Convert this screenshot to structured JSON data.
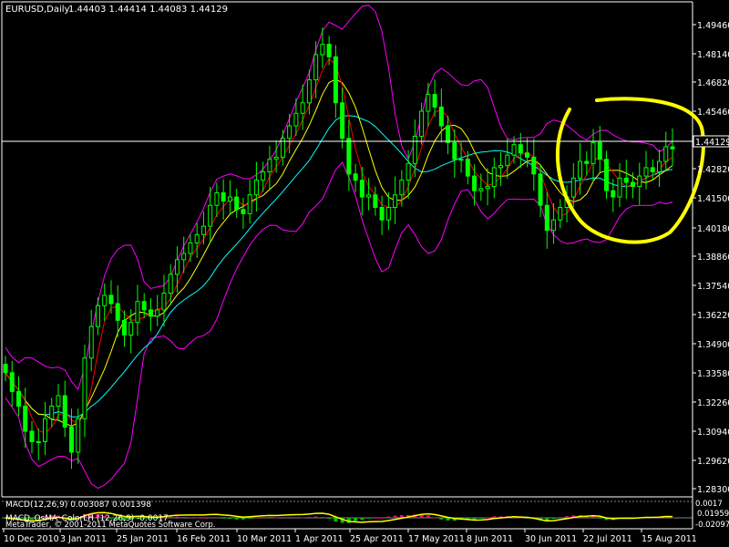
{
  "chart_header": {
    "symbol_label": "EURUSD,Daily",
    "ohlc_text": "1.44403 1.44414 1.44083 1.44129"
  },
  "price_axis": {
    "current_price_label": "1.44129",
    "ticks": [
      "1.49460",
      "1.48140",
      "1.46820",
      "1.45460",
      "1.42820",
      "1.41500",
      "1.40180",
      "1.38860",
      "1.37540",
      "1.36220",
      "1.34900",
      "1.33580",
      "1.32260",
      "1.30940",
      "1.29620",
      "1.28300"
    ]
  },
  "time_axis": {
    "labels": [
      "10 Dec 2010",
      "3 Jan 2011",
      "25 Jan 2011",
      "16 Feb 2011",
      "10 Mar 2011",
      "1 Apr 2011",
      "25 Apr 2011",
      "17 May 2011",
      "8 Jun 2011",
      "30 Jun 2011",
      "22 Jul 2011",
      "15 Aug 2011"
    ]
  },
  "indicator_panel": {
    "macd_label": "MACD(12,26,9) 0.003087 0.001398",
    "osma_label": "MACD_OsMA_ColorLH (12,26,9) -0.0017",
    "copyright": "MetaTrader, © 2001-2011 MetaQuotes Software Corp.",
    "axis_top": "0.01959",
    "axis_bottom": "-0.02097",
    "axis_extra": "0.0017"
  },
  "colors": {
    "background": "#000000",
    "candles": "#00ff00",
    "bollinger": "#ff00ff",
    "ma_fast": "#ff0000",
    "ma_mid": "#ffff00",
    "ma_slow": "#00ffff",
    "price_line": "#ffffff",
    "annotation": "#ffff00"
  },
  "chart_data": {
    "type": "candlestick",
    "symbol": "EURUSD",
    "timeframe": "Daily",
    "last": {
      "open": 1.44403,
      "high": 1.44414,
      "low": 1.44083,
      "close": 1.44129
    },
    "ylim": [
      1.2768,
      1.5078
    ],
    "x_ticks": [
      "10 Dec 2010",
      "3 Jan 2011",
      "25 Jan 2011",
      "16 Feb 2011",
      "10 Mar 2011",
      "1 Apr 2011",
      "25 Apr 2011",
      "17 May 2011",
      "8 Jun 2011",
      "30 Jun 2011",
      "22 Jul 2011",
      "15 Aug 2011"
    ],
    "close_path": [
      1.334,
      1.325,
      1.318,
      1.306,
      1.301,
      1.301,
      1.312,
      1.318,
      1.323,
      1.308,
      1.296,
      1.312,
      1.341,
      1.356,
      1.366,
      1.371,
      1.367,
      1.359,
      1.352,
      1.358,
      1.368,
      1.364,
      1.361,
      1.364,
      1.372,
      1.381,
      1.388,
      1.391,
      1.396,
      1.4,
      1.404,
      1.414,
      1.42,
      1.416,
      1.418,
      1.412,
      1.41,
      1.419,
      1.426,
      1.43,
      1.436,
      1.437,
      1.446,
      1.452,
      1.458,
      1.463,
      1.474,
      1.486,
      1.491,
      1.485,
      1.463,
      1.446,
      1.429,
      1.426,
      1.418,
      1.419,
      1.413,
      1.407,
      1.413,
      1.419,
      1.426,
      1.434,
      1.447,
      1.459,
      1.467,
      1.461,
      1.452,
      1.444,
      1.436,
      1.436,
      1.428,
      1.421,
      1.422,
      1.423,
      1.432,
      1.433,
      1.438,
      1.443,
      1.439,
      1.437,
      1.429,
      1.414,
      1.402,
      1.407,
      1.413,
      1.418,
      1.427,
      1.435,
      1.434,
      1.444,
      1.436,
      1.421,
      1.418,
      1.427,
      1.425,
      1.423,
      1.428,
      1.432,
      1.43,
      1.435,
      1.442,
      1.441
    ],
    "indicators": [
      "Bollinger Bands",
      "Moving Average (fast)",
      "Moving Average (mid)",
      "Moving Average (slow)",
      "MACD(12,26,9)",
      "MACD_OsMA_ColorLH"
    ]
  }
}
